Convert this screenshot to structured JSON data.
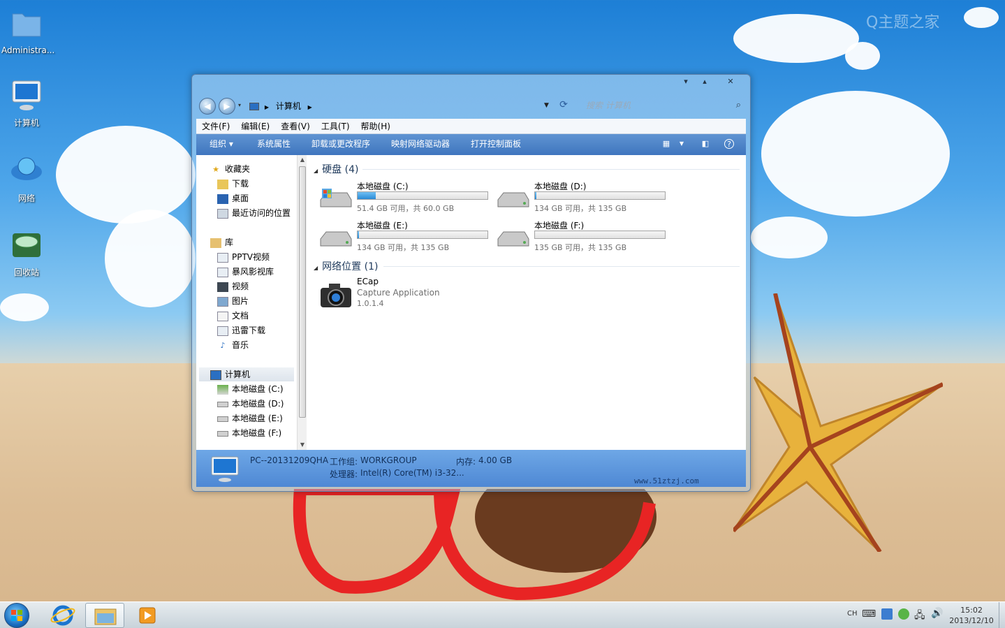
{
  "desktop": {
    "icons": [
      {
        "label": "Administra..."
      },
      {
        "label": "计算机"
      },
      {
        "label": "网络"
      },
      {
        "label": "回收站"
      }
    ],
    "corner_watermark": "Q主题之家"
  },
  "window": {
    "controls": {
      "minimize": "▾",
      "maximize": "▴",
      "close": "✕"
    },
    "address": {
      "crumb": "计算机"
    },
    "search": {
      "placeholder": "搜索 计算机"
    },
    "menu": [
      "文件(F)",
      "编辑(E)",
      "查看(V)",
      "工具(T)",
      "帮助(H)"
    ],
    "toolbar": {
      "organize": "组织 ▾",
      "system_properties": "系统属性",
      "uninstall": "卸载或更改程序",
      "map_drive": "映射网络驱动器",
      "control_panel": "打开控制面板"
    },
    "nav": {
      "favorites": "收藏夹",
      "downloads": "下载",
      "desktop": "桌面",
      "recent": "最近访问的位置",
      "libraries": "库",
      "pptv": "PPTV视频",
      "baofeng": "暴风影视库",
      "videos": "视频",
      "pictures": "图片",
      "documents": "文档",
      "thunder": "迅雷下载",
      "music": "音乐",
      "computer": "计算机",
      "drive_c": "本地磁盘 (C:)",
      "drive_d": "本地磁盘 (D:)",
      "drive_e": "本地磁盘 (E:)",
      "drive_f": "本地磁盘 (F:)"
    },
    "content": {
      "hard_disks_header": "硬盘 (4)",
      "drives": [
        {
          "name": "本地磁盘 (C:)",
          "info": "51.4 GB 可用，共 60.0 GB",
          "used_fraction": 0.14
        },
        {
          "name": "本地磁盘 (D:)",
          "info": "134 GB 可用，共 135 GB",
          "used_fraction": 0.01
        },
        {
          "name": "本地磁盘 (E:)",
          "info": "134 GB 可用，共 135 GB",
          "used_fraction": 0.01
        },
        {
          "name": "本地磁盘 (F:)",
          "info": "135 GB 可用，共 135 GB",
          "used_fraction": 0.0
        }
      ],
      "network_header": "网络位置 (1)",
      "network_item": {
        "name": "ECap",
        "desc": "Capture Application",
        "version": "1.0.1.4"
      }
    },
    "details": {
      "pc_name": "PC--20131209QHA",
      "workgroup_label": "工作组:",
      "workgroup": "WORKGROUP",
      "memory_label": "内存:",
      "memory": "4.00 GB",
      "cpu_label": "处理器:",
      "cpu": "Intel(R) Core(TM) i3-32...",
      "url": "www.51ztzj.com"
    }
  },
  "taskbar": {
    "lang": "CH",
    "time": "15:02",
    "date": "2013/12/10"
  }
}
